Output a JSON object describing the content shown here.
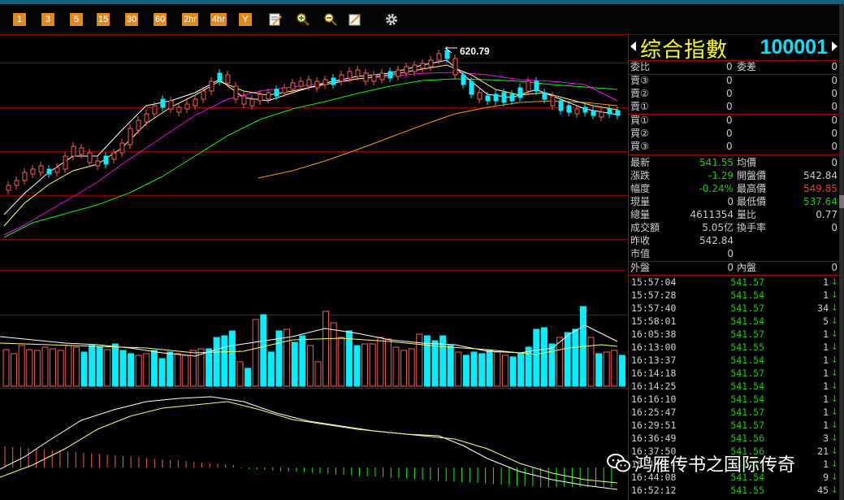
{
  "toolbar": {
    "periods": [
      "1",
      "3",
      "5",
      "15",
      "30",
      "60",
      "2hr",
      "4hr",
      "Y"
    ],
    "tools": [
      "chart-edit-icon",
      "zoom-in-icon",
      "zoom-out-icon",
      "draw-line-icon",
      "gear-icon"
    ]
  },
  "chart": {
    "high_label": "620.79",
    "colors": {
      "up": "#ff5a5a",
      "down": "#00f0ff",
      "grid": "#8b0000",
      "ma5": "#ffffff",
      "ma10": "#ffff66",
      "ma20": "#ff00ff",
      "ma60": "#00ff00",
      "ma120": "#ff9900"
    }
  },
  "quote": {
    "name": "综合指數",
    "code": "100001",
    "order_book": {
      "webi_label": "委比",
      "webi_value": "0",
      "wecha_label": "委差",
      "wecha_value": "0",
      "asks": [
        {
          "label": "賣③",
          "price": "0",
          "vol": "0"
        },
        {
          "label": "賣②",
          "price": "0",
          "vol": "0"
        },
        {
          "label": "賣①",
          "price": "0",
          "vol": "0"
        }
      ],
      "bids": [
        {
          "label": "買①",
          "price": "0",
          "vol": "0"
        },
        {
          "label": "買②",
          "price": "0",
          "vol": "0"
        },
        {
          "label": "買③",
          "price": "0",
          "vol": "0"
        }
      ]
    },
    "stats": {
      "last_label": "最新",
      "last_value": "541.55",
      "avg_label": "均價",
      "avg_value": "0",
      "change_label": "漲跌",
      "change_value": "-1.29",
      "open_label": "開盤價",
      "open_value": "542.84",
      "pct_label": "幅度",
      "pct_value": "-0.24%",
      "high_label": "最高價",
      "high_value": "549.85",
      "curvol_label": "現量",
      "curvol_value": "0",
      "low_label": "最低價",
      "low_value": "537.64",
      "totvol_label": "總量",
      "totvol_value": "4611354",
      "volratio_label": "量比",
      "volratio_value": "0.77",
      "amount_label": "成交額",
      "amount_value": "5.05亿",
      "turnover_label": "換手率",
      "turnover_value": "0",
      "prevclose_label": "昨收",
      "prevclose_value": "542.84",
      "mktval_label": "市值",
      "mktval_value": "0",
      "outer_label": "外盤",
      "outer_value": "0",
      "inner_label": "內盤",
      "inner_value": "0"
    },
    "ticks": [
      {
        "time": "15:57:04",
        "price": "541.57",
        "vol": "1",
        "dir": "↓"
      },
      {
        "time": "15:57:28",
        "price": "541.54",
        "vol": "1",
        "dir": "↓"
      },
      {
        "time": "15:57:40",
        "price": "541.57",
        "vol": "34",
        "dir": "↓"
      },
      {
        "time": "15:58:01",
        "price": "541.54",
        "vol": "5",
        "dir": "↓"
      },
      {
        "time": "16:05:38",
        "price": "541.57",
        "vol": "1",
        "dir": "↓"
      },
      {
        "time": "16:13:00",
        "price": "541.55",
        "vol": "1",
        "dir": "↓"
      },
      {
        "time": "16:13:37",
        "price": "541.54",
        "vol": "1",
        "dir": "↓"
      },
      {
        "time": "16:14:18",
        "price": "541.57",
        "vol": "1",
        "dir": "↓"
      },
      {
        "time": "16:14:25",
        "price": "541.54",
        "vol": "1",
        "dir": "↓"
      },
      {
        "time": "16:16:10",
        "price": "541.54",
        "vol": "1",
        "dir": "↓"
      },
      {
        "time": "16:25:47",
        "price": "541.57",
        "vol": "1",
        "dir": "↓"
      },
      {
        "time": "16:29:51",
        "price": "541.57",
        "vol": "1",
        "dir": "↓"
      },
      {
        "time": "16:36:49",
        "price": "541.56",
        "vol": "3",
        "dir": "↓"
      },
      {
        "time": "16:37:50",
        "price": "541.56",
        "vol": "21",
        "dir": "↓"
      },
      {
        "time": "16:43:14",
        "price": "541.57",
        "vol": "1",
        "dir": "↓"
      },
      {
        "time": "16:44:08",
        "price": "541.54",
        "vol": "9",
        "dir": "↓"
      },
      {
        "time": "16:52:12",
        "price": "541.55",
        "vol": "45",
        "dir": "↓"
      }
    ]
  },
  "watermark": {
    "text": "鸿雁传书之国际传奇",
    "icon": "wechat-icon"
  }
}
